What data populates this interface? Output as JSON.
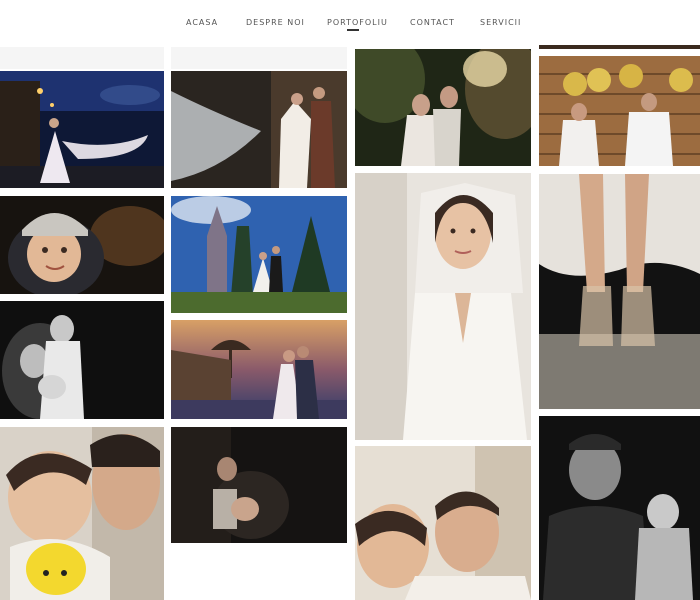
{
  "nav": {
    "items": [
      "ACASA",
      "DESPRE NOI",
      "PORTOFOLIU",
      "CONTACT",
      "SERVICII"
    ],
    "active": "PORTOFOLIU"
  },
  "gallery": {
    "photos": [
      {
        "id": "bride-veil-night-street",
        "palette": [
          "#0d1a3a",
          "#2b3f7a",
          "#e8e2ea"
        ]
      },
      {
        "id": "couple-bridal-veil-wall",
        "palette": [
          "#1c1814",
          "#6a4a32",
          "#f1ece6"
        ]
      },
      {
        "id": "couple-forest-embrace",
        "palette": [
          "#1b2312",
          "#4a5a2c",
          "#d9d0c0"
        ]
      },
      {
        "id": "couple-gold-balloons-2022",
        "palette": [
          "#7a5632",
          "#c79a5a",
          "#e3c25a"
        ]
      },
      {
        "id": "toddler-knit-hat",
        "palette": [
          "#1a1612",
          "#6b4a2e",
          "#d8c4a8"
        ]
      },
      {
        "id": "couple-castle-blue-sky",
        "palette": [
          "#1d4c9a",
          "#3b6fb9",
          "#dfe4ea"
        ]
      },
      {
        "id": "bride-portrait-white-robe",
        "palette": [
          "#e9e6e1",
          "#cfc9c0",
          "#7a5a48"
        ]
      },
      {
        "id": "bride-shoes-dress",
        "palette": [
          "#1a1a1a",
          "#8a7f74",
          "#d9c7b5"
        ]
      },
      {
        "id": "family-bw-portrait",
        "palette": [
          "#111111",
          "#555555",
          "#dddddd"
        ]
      },
      {
        "id": "couple-sunset-beach",
        "palette": [
          "#2d1f3a",
          "#c47a3a",
          "#2a3f6b"
        ]
      },
      {
        "id": "mother-baby-yellow-hat",
        "palette": [
          "#d8d0c4",
          "#b88a6a",
          "#f2d12e"
        ]
      },
      {
        "id": "father-baby-dark",
        "palette": [
          "#121010",
          "#3a302a",
          "#b9a28a"
        ]
      },
      {
        "id": "parents-newborn",
        "palette": [
          "#e7e1d8",
          "#bfa390",
          "#7a5a40"
        ]
      },
      {
        "id": "father-baby-bw",
        "palette": [
          "#0f0f0f",
          "#4a4a4a",
          "#cfcfcf"
        ]
      }
    ]
  }
}
